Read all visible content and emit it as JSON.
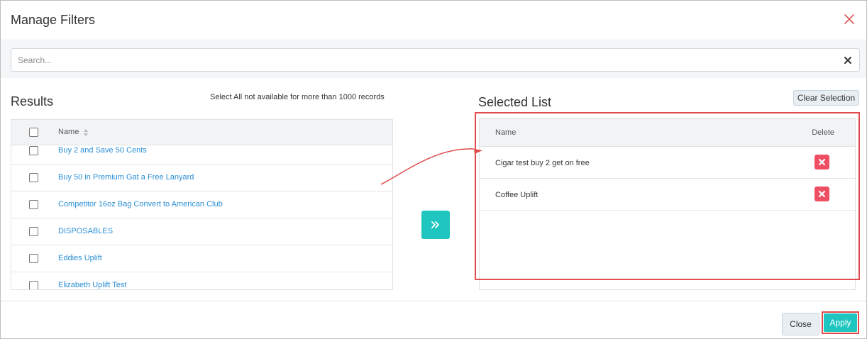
{
  "dialog": {
    "title": "Manage Filters"
  },
  "search": {
    "placeholder": "Search...",
    "value": ""
  },
  "results": {
    "title": "Results",
    "note": "Select All not available for more than 1000 records",
    "column_name": "Name",
    "rows": [
      "Buy 2 and Save 50 Cents",
      "Buy 50 in Premium Gat a Free Lanyard",
      "Competitor 16oz Bag Convert to American Club",
      "DISPOSABLES",
      "Eddies Uplift",
      "Elizabeth Uplift Test"
    ]
  },
  "selected": {
    "title": "Selected List",
    "clear_label": "Clear Selection",
    "column_name": "Name",
    "column_delete": "Delete",
    "rows": [
      "Cigar test buy 2 get on free",
      "Coffee Uplift"
    ]
  },
  "footer": {
    "close_label": "Close",
    "apply_label": "Apply"
  },
  "colors": {
    "accent": "#1fc6bf",
    "delete": "#ee4f63",
    "link": "#2a8fd6",
    "highlight": "#e04a4a"
  }
}
